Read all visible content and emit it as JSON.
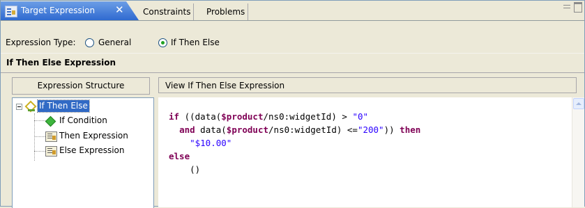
{
  "tabs": {
    "active_label": "Target Expression",
    "close_glyph": "✕",
    "others": [
      "Constraints",
      "Problems"
    ]
  },
  "expression_type": {
    "label": "Expression Type:",
    "options": [
      "General",
      "If Then Else"
    ],
    "selected": "If Then Else"
  },
  "section": {
    "title": "If Then Else Expression"
  },
  "structure": {
    "header": "Expression Structure",
    "root": "If Then Else",
    "children": [
      "If Condition",
      "Then Expression",
      "Else Expression"
    ]
  },
  "view": {
    "header": "View If Then Else Expression",
    "code": {
      "l1_kw": "if",
      "l1_a": " ((data(",
      "l1_var": "$product",
      "l1_b": "/ns0:widgetId) > ",
      "l1_str": "\"0\"",
      "l2_kw": "and",
      "l2_a": " data(",
      "l2_var": "$product",
      "l2_b": "/ns0:widgetId) <=",
      "l2_str": "\"200\"",
      "l2_c": ")) ",
      "l2_kw2": "then",
      "l3_str": "\"$10.00\"",
      "l4_kw": "else",
      "l5": "()"
    }
  },
  "colors": {
    "active_tab": "#2f6ad0",
    "keyword": "#7f0055",
    "string": "#2a00ff",
    "selection": "#316ac5"
  }
}
